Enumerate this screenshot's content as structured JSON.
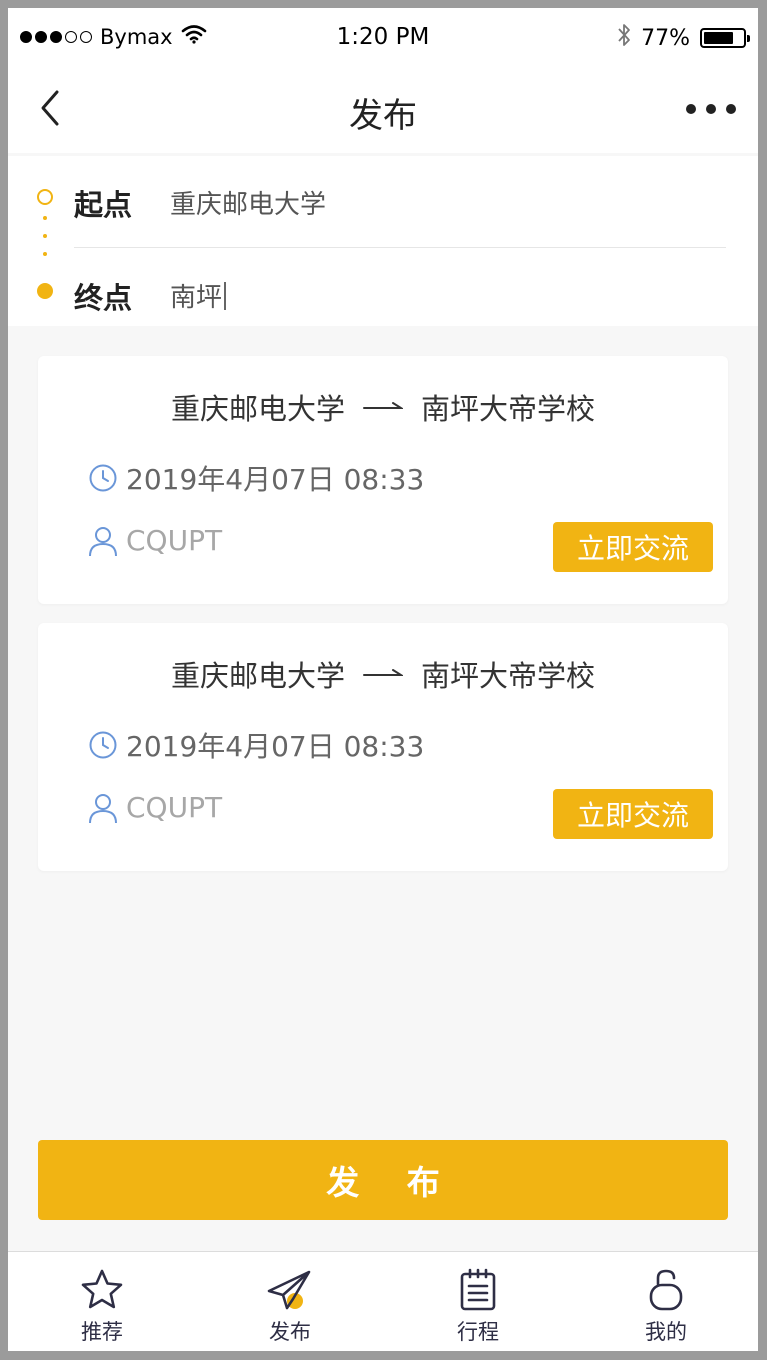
{
  "status_bar": {
    "carrier": "Bymax",
    "time": "1:20 PM",
    "battery": "77%",
    "battery_level": 0.77
  },
  "nav": {
    "title": "发布",
    "back_icon": "chevron-left-icon",
    "more_icon": "more-dots-icon"
  },
  "route": {
    "start_label": "起点",
    "start_value": "重庆邮电大学",
    "end_label": "终点",
    "end_value": "南坪"
  },
  "results": [
    {
      "from": "重庆邮电大学",
      "to": "南坪大帝学校",
      "time": "2019年4月07日  08:33",
      "user": "CQUPT",
      "action": "立即交流"
    },
    {
      "from": "重庆邮电大学",
      "to": "南坪大帝学校",
      "time": "2019年4月07日  08:33",
      "user": "CQUPT",
      "action": "立即交流"
    }
  ],
  "publish_label": "发 布",
  "tabs": [
    {
      "label": "推荐",
      "icon": "star-icon"
    },
    {
      "label": "发布",
      "icon": "paper-plane-icon"
    },
    {
      "label": "行程",
      "icon": "notepad-icon"
    },
    {
      "label": "我的",
      "icon": "user-icon"
    }
  ],
  "colors": {
    "accent": "#f1b413",
    "icon_blue": "#6a96d8",
    "tab_icon": "#2e2e45"
  }
}
